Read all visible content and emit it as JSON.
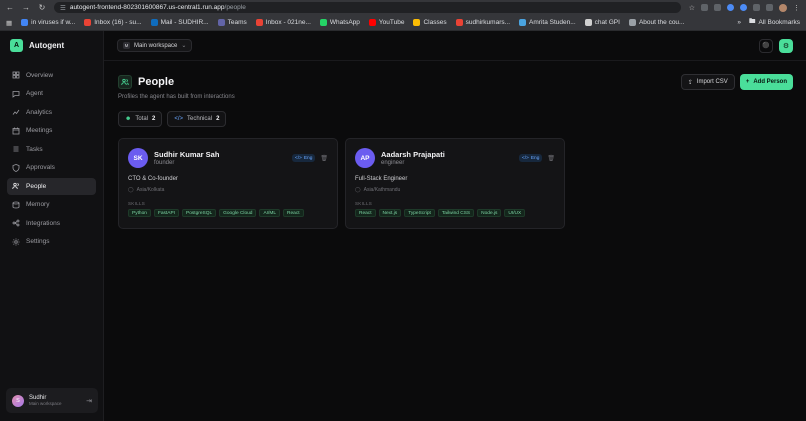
{
  "browser": {
    "url_host": "autogent-frontend-802301600867.us-central1.run.app",
    "url_path": "/people",
    "bookmarks": [
      {
        "label": "in viruses if w...",
        "color": "#4285f4"
      },
      {
        "label": "Inbox (16) - su...",
        "color": "#ea4335"
      },
      {
        "label": "Mail - SUDHIR...",
        "color": "#0f6cbd"
      },
      {
        "label": "Teams",
        "color": "#6264a7"
      },
      {
        "label": "Inbox - 021ne...",
        "color": "#ea4335"
      },
      {
        "label": "WhatsApp",
        "color": "#25d366"
      },
      {
        "label": "YouTube",
        "color": "#ff0000"
      },
      {
        "label": "Classes",
        "color": "#fbbc04"
      },
      {
        "label": "sudhirkumars...",
        "color": "#ea4335"
      },
      {
        "label": "Amrita Studen...",
        "color": "#4aa3df"
      },
      {
        "label": "chat GPI",
        "color": "#d0d0d0"
      },
      {
        "label": "About the cou...",
        "color": "#9aa0a6"
      }
    ],
    "all_bookmarks": "All Bookmarks"
  },
  "app": {
    "brand_letter": "A",
    "brand_name": "Autogent",
    "nav": [
      {
        "label": "Overview",
        "icon": "grid-icon",
        "active": false
      },
      {
        "label": "Agent",
        "icon": "chat-icon",
        "active": false
      },
      {
        "label": "Analytics",
        "icon": "analytics-icon",
        "active": false
      },
      {
        "label": "Meetings",
        "icon": "calendar-icon",
        "active": false
      },
      {
        "label": "Tasks",
        "icon": "tasks-icon",
        "active": false
      },
      {
        "label": "Approvals",
        "icon": "shield-icon",
        "active": false
      },
      {
        "label": "People",
        "icon": "people-icon",
        "active": true
      },
      {
        "label": "Memory",
        "icon": "memory-icon",
        "active": false
      },
      {
        "label": "Integrations",
        "icon": "integrations-icon",
        "active": false
      },
      {
        "label": "Settings",
        "icon": "gear-icon",
        "active": false
      }
    ],
    "user": {
      "initial": "S",
      "name": "Sudhir",
      "workspace": "Main workspace"
    }
  },
  "topbar": {
    "workspace_badge": "M",
    "workspace": "Main workspace"
  },
  "page": {
    "title": "People",
    "subtitle": "Profiles the agent has built from interactions",
    "import_label": "Import CSV",
    "add_label": "Add Person",
    "filters": [
      {
        "label": "Total",
        "count": "2"
      },
      {
        "label": "Technical",
        "count": "2"
      }
    ]
  },
  "people": [
    {
      "initials": "SK",
      "name": "Sudhir Kumar Sah",
      "role": "founder",
      "tag": "Eng",
      "title": "CTO & Co-founder",
      "location": "Asia/Kolkata",
      "skills_label": "SKILLS",
      "skills": [
        "Python",
        "FastAPI",
        "PostgreSQL",
        "Google Cloud",
        "AI/ML",
        "React"
      ]
    },
    {
      "initials": "AP",
      "name": "Aadarsh Prajapati",
      "role": "engineer",
      "tag": "Eng",
      "title": "Full-Stack Engineer",
      "location": "Asia/Kathmandu",
      "skills_label": "SKILLS",
      "skills": [
        "React",
        "Next.js",
        "TypeScript",
        "Tailwind CSS",
        "Node.js",
        "UI/UX"
      ]
    }
  ],
  "colors": {
    "accent": "#4ade9a",
    "avatar": "#6b5cf0",
    "tag": "#6aa7ff"
  }
}
